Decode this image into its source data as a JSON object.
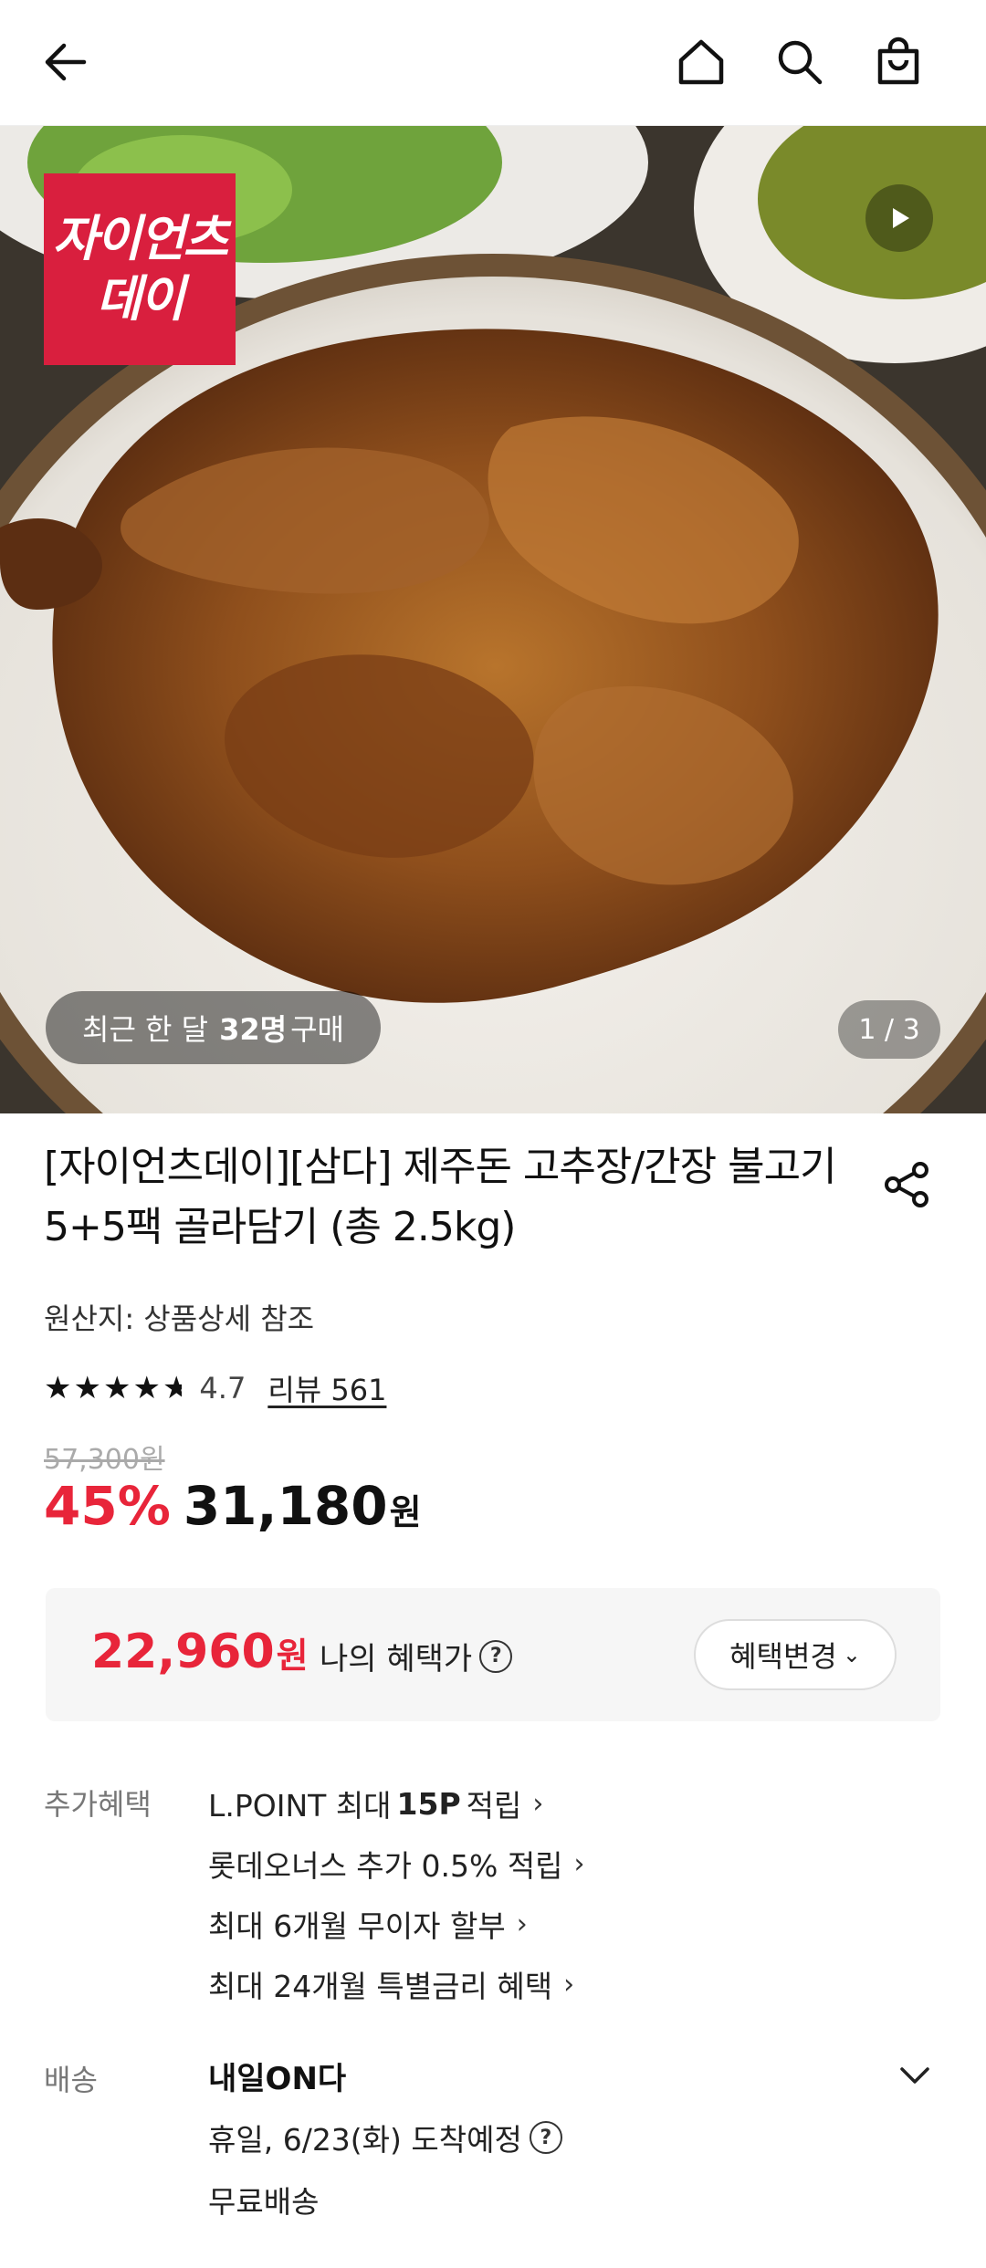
{
  "header": {
    "back_icon": "arrow-left-icon",
    "home_icon": "home-icon",
    "search_icon": "search-icon",
    "cart_icon": "shopping-bag-icon"
  },
  "hero": {
    "logo_line1": "자이언츠",
    "logo_line2": "데이",
    "buyers_prefix": "최근 한 달",
    "buyers_count": "32명",
    "buyers_suffix": "구매",
    "image_counter": "1 / 3"
  },
  "product": {
    "title": "[자이언츠데이][삼다] 제주돈 고추장/간장 불고기 5+5팩 골라담기 (총 2.5kg)",
    "origin": "원산지: 상품상세 참조",
    "rating": "4.7",
    "review_link": "리뷰 561",
    "original_price": "57,300원",
    "discount": "45%",
    "sale_price": "31,180",
    "sale_unit": "원"
  },
  "benefit_box": {
    "price": "22,960",
    "unit": "원",
    "label": "나의 혜택가",
    "change_button": "혜택변경"
  },
  "extra_benefits": {
    "label": "추가혜택",
    "items": [
      {
        "prefix": "L.POINT 최대",
        "bold": "15P",
        "suffix": "적립"
      },
      {
        "prefix": "롯데오너스 추가 0.5% 적립",
        "bold": "",
        "suffix": ""
      },
      {
        "prefix": "최대 6개월 무이자 할부",
        "bold": "",
        "suffix": ""
      },
      {
        "prefix": "최대 24개월 특별금리 혜택",
        "bold": "",
        "suffix": ""
      }
    ]
  },
  "delivery": {
    "label": "배송",
    "title": "내일ON다",
    "date": "휴일, 6/23(화) 도착예정",
    "fee": "무료배송"
  },
  "colors": {
    "accent_red": "#e8253a",
    "logo_red": "#d91f3e"
  }
}
